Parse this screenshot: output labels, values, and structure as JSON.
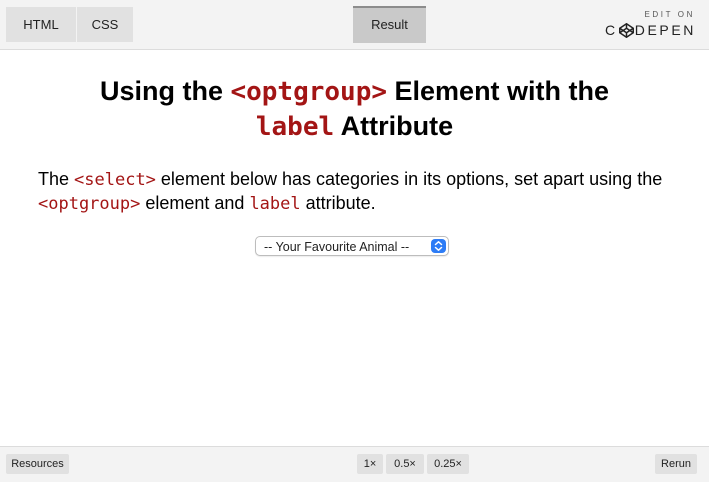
{
  "editor": {
    "tabs": [
      {
        "label": "HTML"
      },
      {
        "label": "CSS"
      },
      {
        "label": "Result"
      }
    ],
    "edit_on": "EDIT ON",
    "codepen_c": "C",
    "codepen_rest": "DEPEN"
  },
  "result": {
    "heading": {
      "part1": "Using the ",
      "code1": "<optgroup>",
      "part2": " Element with the ",
      "code2": "label",
      "part3": " Attribute"
    },
    "intro": {
      "t1": "The ",
      "c1": "<select>",
      "t2": " element below has categories in its options, set apart using the ",
      "c2": "<optgroup>",
      "t3": " element and ",
      "c3": "label",
      "t4": " attribute."
    },
    "select": {
      "value": "-- Your Favourite Animal --"
    }
  },
  "footer": {
    "resources": "Resources",
    "zoom": [
      "1×",
      "0.5×",
      "0.25×"
    ],
    "rerun": "Rerun"
  },
  "colors": {
    "code": "#a31515",
    "select_arrow": "#2d7cf6",
    "bar_bg": "#f3f3f3"
  }
}
